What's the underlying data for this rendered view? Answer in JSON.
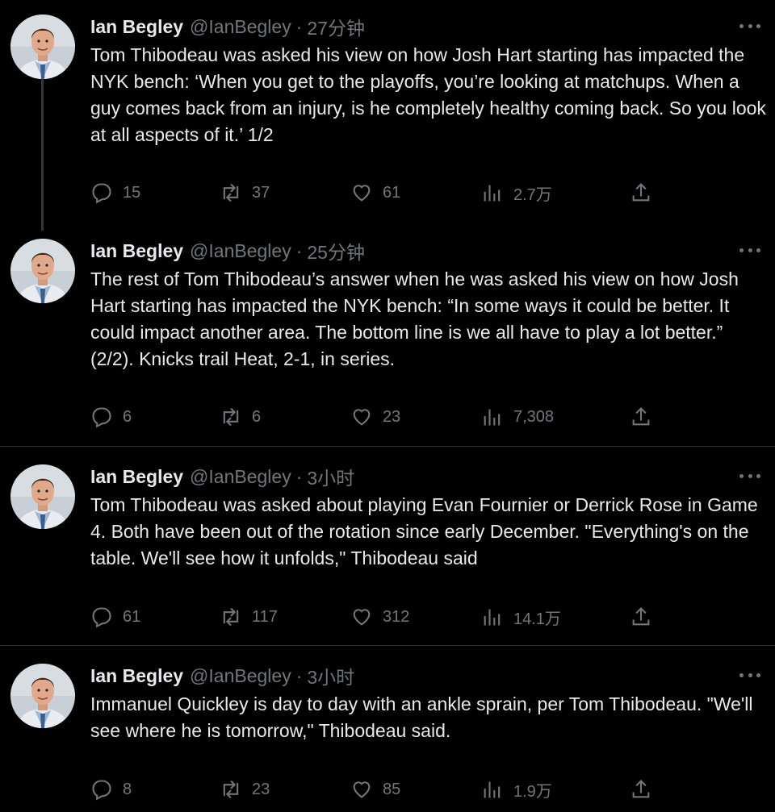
{
  "colors": {
    "background": "#000000",
    "text": "#e7e9ea",
    "muted": "#71767b",
    "divider": "#2f3336"
  },
  "icons": {
    "reply": "reply-icon",
    "retweet": "retweet-icon",
    "like": "heart-icon",
    "views": "views-icon",
    "share": "share-icon",
    "more": "more-icon"
  },
  "tweets": [
    {
      "name": "Ian Begley",
      "handle": "@IanBegley",
      "separator": "·",
      "time": "27分钟",
      "text": "Tom Thibodeau was asked his view on how Josh Hart starting has impacted the NYK bench: ‘When you get to the playoffs, you’re looking at matchups. When a guy comes back from an injury, is he completely healthy coming back. So you look at all aspects of it.’ 1/2",
      "replies": "15",
      "retweets": "37",
      "likes": "61",
      "views": "2.7万"
    },
    {
      "name": "Ian Begley",
      "handle": "@IanBegley",
      "separator": "·",
      "time": "25分钟",
      "text": "The rest of Tom Thibodeau’s answer when he was asked his view on how Josh Hart starting has impacted the NYK bench: “In some ways it could be better. It could impact another area. The bottom line is we all have to play a lot better.” (2/2). Knicks trail Heat, 2-1, in series.",
      "replies": "6",
      "retweets": "6",
      "likes": "23",
      "views": "7,308"
    },
    {
      "name": "Ian Begley",
      "handle": "@IanBegley",
      "separator": "·",
      "time": "3小时",
      "text": "Tom Thibodeau was asked about playing Evan Fournier or Derrick Rose in Game 4. Both have been out of the rotation since early December. \"Everything's on the table. We'll see how it unfolds,\" Thibodeau said",
      "replies": "61",
      "retweets": "117",
      "likes": "312",
      "views": "14.1万"
    },
    {
      "name": "Ian Begley",
      "handle": "@IanBegley",
      "separator": "·",
      "time": "3小时",
      "text": "Immanuel Quickley is day to day with an ankle sprain, per Tom Thibodeau. \"We'll see where he is tomorrow,\" Thibodeau said.",
      "replies": "8",
      "retweets": "23",
      "likes": "85",
      "views": "1.9万"
    }
  ]
}
